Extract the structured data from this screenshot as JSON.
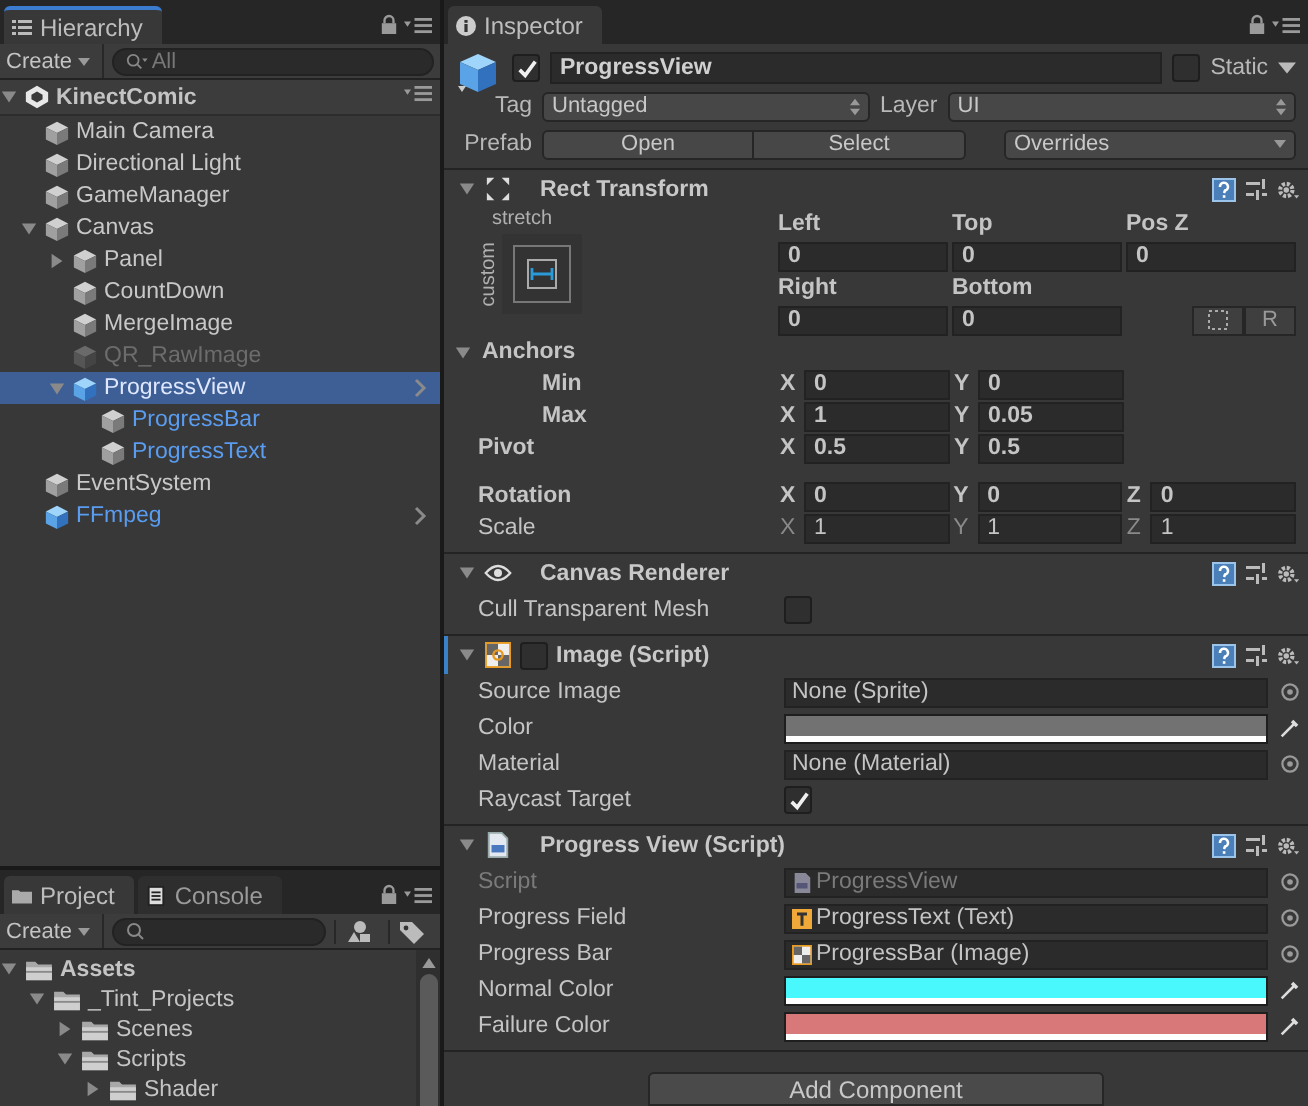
{
  "hierarchy": {
    "tab": "Hierarchy",
    "create": "Create",
    "search_placeholder": "All",
    "scene": {
      "name": "KinectComic",
      "expanded": true
    },
    "items": [
      {
        "name": "Main Camera",
        "kind": "object",
        "selected": false
      },
      {
        "name": "Directional Light",
        "kind": "object",
        "selected": false
      },
      {
        "name": "GameManager",
        "kind": "object",
        "selected": false
      },
      {
        "name": "Canvas",
        "kind": "object",
        "selected": false,
        "expanded": true,
        "children": [
          {
            "name": "Panel",
            "kind": "object",
            "selected": false,
            "expanded": false
          },
          {
            "name": "CountDown",
            "kind": "object",
            "selected": false
          },
          {
            "name": "MergeImage",
            "kind": "object",
            "selected": false
          },
          {
            "name": "QR_RawImage",
            "kind": "inactive",
            "selected": false
          },
          {
            "name": "ProgressView",
            "kind": "prefab_root",
            "selected": true,
            "expanded": true,
            "children": [
              {
                "name": "ProgressBar",
                "kind": "prefab_part",
                "selected": false
              },
              {
                "name": "ProgressText",
                "kind": "prefab_part",
                "selected": false
              }
            ]
          }
        ]
      },
      {
        "name": "EventSystem",
        "kind": "object",
        "selected": false
      },
      {
        "name": "FFmpeg",
        "kind": "prefab_root",
        "selected": false
      }
    ]
  },
  "project": {
    "tabs": [
      {
        "label": "Project",
        "selected": true
      },
      {
        "label": "Console",
        "selected": false
      }
    ],
    "create": "Create",
    "items": [
      {
        "name": "Assets",
        "expanded": true,
        "children": [
          {
            "name": "_Tint_Projects",
            "expanded": true,
            "children": [
              {
                "name": "Scenes",
                "expanded": false
              },
              {
                "name": "Scripts",
                "expanded": true,
                "children": [
                  {
                    "name": "Shader",
                    "expanded": false
                  }
                ]
              }
            ]
          }
        ]
      }
    ]
  },
  "inspector": {
    "tab": "Inspector",
    "object": {
      "active": true,
      "name": "ProgressView",
      "static": false,
      "static_label": "Static",
      "tag_label": "Tag",
      "tag": "Untagged",
      "layer_label": "Layer",
      "layer": "UI",
      "prefab_label": "Prefab",
      "prefab_buttons": [
        "Open",
        "Select"
      ],
      "overrides": "Overrides"
    },
    "rect_transform": {
      "title": "Rect Transform",
      "expanded": true,
      "preset_top": "stretch",
      "preset_side": "custom",
      "offsets": [
        {
          "label": "Left",
          "value": "0"
        },
        {
          "label": "Top",
          "value": "0"
        },
        {
          "label": "Pos Z",
          "value": "0"
        },
        {
          "label": "Right",
          "value": "0"
        },
        {
          "label": "Bottom",
          "value": "0"
        }
      ],
      "raw_button": "R",
      "anchors": {
        "label": "Anchors",
        "expanded": true,
        "rows": [
          {
            "label": "Min",
            "overridden": true,
            "fields": [
              {
                "axis": "X",
                "value": "0"
              },
              {
                "axis": "Y",
                "value": "0"
              }
            ]
          },
          {
            "label": "Max",
            "overridden": true,
            "fields": [
              {
                "axis": "X",
                "value": "1"
              },
              {
                "axis": "Y",
                "value": "0.05"
              }
            ]
          }
        ]
      },
      "rows": [
        {
          "label": "Pivot",
          "overridden": true,
          "fields": [
            {
              "axis": "X",
              "value": "0.5"
            },
            {
              "axis": "Y",
              "value": "0.5"
            }
          ]
        },
        {
          "label": "Rotation",
          "overridden": true,
          "fields": [
            {
              "axis": "X",
              "value": "0"
            },
            {
              "axis": "Y",
              "value": "0"
            },
            {
              "axis": "Z",
              "value": "0"
            }
          ]
        },
        {
          "label": "Scale",
          "overridden": false,
          "fields": [
            {
              "axis": "X",
              "value": "1"
            },
            {
              "axis": "Y",
              "value": "1"
            },
            {
              "axis": "Z",
              "value": "1"
            }
          ]
        }
      ]
    },
    "components": [
      {
        "kind": "canvas_renderer",
        "title": "Canvas Renderer",
        "expanded": true,
        "fields": [
          {
            "kind": "checkbox",
            "label": "Cull Transparent Mesh",
            "checked": false
          }
        ]
      },
      {
        "kind": "image",
        "title": "Image (Script)",
        "expanded": true,
        "enabled": false,
        "fields": [
          {
            "kind": "object",
            "label": "Source Image",
            "value": "None (Sprite)"
          },
          {
            "kind": "color",
            "label": "Color",
            "color": "#727272"
          },
          {
            "kind": "object",
            "label": "Material",
            "value": "None (Material)"
          },
          {
            "kind": "checkbox",
            "label": "Raycast Target",
            "checked": true
          }
        ]
      },
      {
        "kind": "script",
        "title": "Progress View (Script)",
        "expanded": true,
        "fields": [
          {
            "kind": "script_ref",
            "label": "Script",
            "value": "ProgressView",
            "disabled": true
          },
          {
            "kind": "text_ref",
            "label": "Progress Field",
            "value": "ProgressText (Text)",
            "disabled": false
          },
          {
            "kind": "image_ref",
            "label": "Progress Bar",
            "value": "ProgressBar (Image)",
            "disabled": false
          },
          {
            "kind": "color",
            "label": "Normal Color",
            "color": "#48f8fc"
          },
          {
            "kind": "color",
            "label": "Failure Color",
            "color": "#d87878"
          }
        ]
      }
    ],
    "add_component": "Add Component"
  }
}
